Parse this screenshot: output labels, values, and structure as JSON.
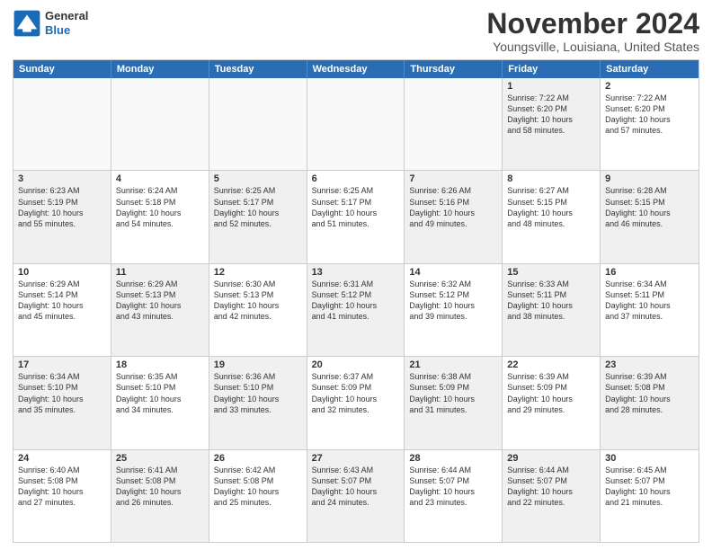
{
  "logo": {
    "general": "General",
    "blue": "Blue"
  },
  "header": {
    "month": "November 2024",
    "location": "Youngsville, Louisiana, United States"
  },
  "weekdays": [
    "Sunday",
    "Monday",
    "Tuesday",
    "Wednesday",
    "Thursday",
    "Friday",
    "Saturday"
  ],
  "rows": [
    [
      {
        "day": "",
        "info": "",
        "empty": true
      },
      {
        "day": "",
        "info": "",
        "empty": true
      },
      {
        "day": "",
        "info": "",
        "empty": true
      },
      {
        "day": "",
        "info": "",
        "empty": true
      },
      {
        "day": "",
        "info": "",
        "empty": true
      },
      {
        "day": "1",
        "info": "Sunrise: 7:22 AM\nSunset: 6:20 PM\nDaylight: 10 hours\nand 58 minutes.",
        "empty": false,
        "shaded": true
      },
      {
        "day": "2",
        "info": "Sunrise: 7:22 AM\nSunset: 6:20 PM\nDaylight: 10 hours\nand 57 minutes.",
        "empty": false,
        "shaded": false
      }
    ],
    [
      {
        "day": "3",
        "info": "Sunrise: 6:23 AM\nSunset: 5:19 PM\nDaylight: 10 hours\nand 55 minutes.",
        "empty": false,
        "shaded": true
      },
      {
        "day": "4",
        "info": "Sunrise: 6:24 AM\nSunset: 5:18 PM\nDaylight: 10 hours\nand 54 minutes.",
        "empty": false,
        "shaded": false
      },
      {
        "day": "5",
        "info": "Sunrise: 6:25 AM\nSunset: 5:17 PM\nDaylight: 10 hours\nand 52 minutes.",
        "empty": false,
        "shaded": true
      },
      {
        "day": "6",
        "info": "Sunrise: 6:25 AM\nSunset: 5:17 PM\nDaylight: 10 hours\nand 51 minutes.",
        "empty": false,
        "shaded": false
      },
      {
        "day": "7",
        "info": "Sunrise: 6:26 AM\nSunset: 5:16 PM\nDaylight: 10 hours\nand 49 minutes.",
        "empty": false,
        "shaded": true
      },
      {
        "day": "8",
        "info": "Sunrise: 6:27 AM\nSunset: 5:15 PM\nDaylight: 10 hours\nand 48 minutes.",
        "empty": false,
        "shaded": false
      },
      {
        "day": "9",
        "info": "Sunrise: 6:28 AM\nSunset: 5:15 PM\nDaylight: 10 hours\nand 46 minutes.",
        "empty": false,
        "shaded": true
      }
    ],
    [
      {
        "day": "10",
        "info": "Sunrise: 6:29 AM\nSunset: 5:14 PM\nDaylight: 10 hours\nand 45 minutes.",
        "empty": false,
        "shaded": false
      },
      {
        "day": "11",
        "info": "Sunrise: 6:29 AM\nSunset: 5:13 PM\nDaylight: 10 hours\nand 43 minutes.",
        "empty": false,
        "shaded": true
      },
      {
        "day": "12",
        "info": "Sunrise: 6:30 AM\nSunset: 5:13 PM\nDaylight: 10 hours\nand 42 minutes.",
        "empty": false,
        "shaded": false
      },
      {
        "day": "13",
        "info": "Sunrise: 6:31 AM\nSunset: 5:12 PM\nDaylight: 10 hours\nand 41 minutes.",
        "empty": false,
        "shaded": true
      },
      {
        "day": "14",
        "info": "Sunrise: 6:32 AM\nSunset: 5:12 PM\nDaylight: 10 hours\nand 39 minutes.",
        "empty": false,
        "shaded": false
      },
      {
        "day": "15",
        "info": "Sunrise: 6:33 AM\nSunset: 5:11 PM\nDaylight: 10 hours\nand 38 minutes.",
        "empty": false,
        "shaded": true
      },
      {
        "day": "16",
        "info": "Sunrise: 6:34 AM\nSunset: 5:11 PM\nDaylight: 10 hours\nand 37 minutes.",
        "empty": false,
        "shaded": false
      }
    ],
    [
      {
        "day": "17",
        "info": "Sunrise: 6:34 AM\nSunset: 5:10 PM\nDaylight: 10 hours\nand 35 minutes.",
        "empty": false,
        "shaded": true
      },
      {
        "day": "18",
        "info": "Sunrise: 6:35 AM\nSunset: 5:10 PM\nDaylight: 10 hours\nand 34 minutes.",
        "empty": false,
        "shaded": false
      },
      {
        "day": "19",
        "info": "Sunrise: 6:36 AM\nSunset: 5:10 PM\nDaylight: 10 hours\nand 33 minutes.",
        "empty": false,
        "shaded": true
      },
      {
        "day": "20",
        "info": "Sunrise: 6:37 AM\nSunset: 5:09 PM\nDaylight: 10 hours\nand 32 minutes.",
        "empty": false,
        "shaded": false
      },
      {
        "day": "21",
        "info": "Sunrise: 6:38 AM\nSunset: 5:09 PM\nDaylight: 10 hours\nand 31 minutes.",
        "empty": false,
        "shaded": true
      },
      {
        "day": "22",
        "info": "Sunrise: 6:39 AM\nSunset: 5:09 PM\nDaylight: 10 hours\nand 29 minutes.",
        "empty": false,
        "shaded": false
      },
      {
        "day": "23",
        "info": "Sunrise: 6:39 AM\nSunset: 5:08 PM\nDaylight: 10 hours\nand 28 minutes.",
        "empty": false,
        "shaded": true
      }
    ],
    [
      {
        "day": "24",
        "info": "Sunrise: 6:40 AM\nSunset: 5:08 PM\nDaylight: 10 hours\nand 27 minutes.",
        "empty": false,
        "shaded": false
      },
      {
        "day": "25",
        "info": "Sunrise: 6:41 AM\nSunset: 5:08 PM\nDaylight: 10 hours\nand 26 minutes.",
        "empty": false,
        "shaded": true
      },
      {
        "day": "26",
        "info": "Sunrise: 6:42 AM\nSunset: 5:08 PM\nDaylight: 10 hours\nand 25 minutes.",
        "empty": false,
        "shaded": false
      },
      {
        "day": "27",
        "info": "Sunrise: 6:43 AM\nSunset: 5:07 PM\nDaylight: 10 hours\nand 24 minutes.",
        "empty": false,
        "shaded": true
      },
      {
        "day": "28",
        "info": "Sunrise: 6:44 AM\nSunset: 5:07 PM\nDaylight: 10 hours\nand 23 minutes.",
        "empty": false,
        "shaded": false
      },
      {
        "day": "29",
        "info": "Sunrise: 6:44 AM\nSunset: 5:07 PM\nDaylight: 10 hours\nand 22 minutes.",
        "empty": false,
        "shaded": true
      },
      {
        "day": "30",
        "info": "Sunrise: 6:45 AM\nSunset: 5:07 PM\nDaylight: 10 hours\nand 21 minutes.",
        "empty": false,
        "shaded": false
      }
    ]
  ]
}
